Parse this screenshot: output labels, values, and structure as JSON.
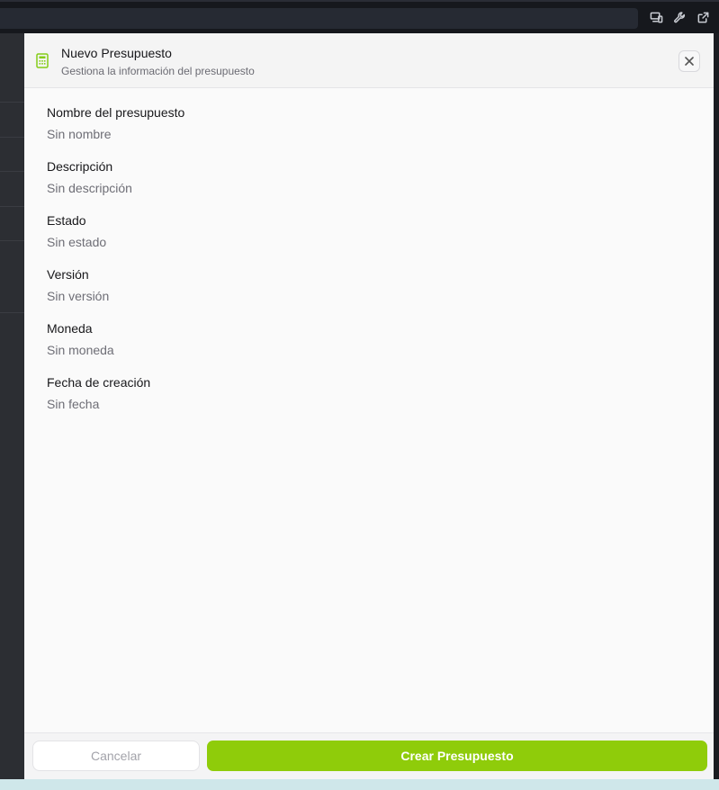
{
  "topbar": {
    "icons": [
      "devices-icon",
      "wrench-icon",
      "external-link-icon"
    ]
  },
  "modal": {
    "icon": "calculator-icon",
    "title": "Nuevo Presupuesto",
    "subtitle": "Gestiona la información del presupuesto",
    "close_icon": "close-icon",
    "fields": [
      {
        "label": "Nombre del presupuesto",
        "value": "Sin nombre"
      },
      {
        "label": "Descripción",
        "value": "Sin descripción"
      },
      {
        "label": "Estado",
        "value": "Sin estado"
      },
      {
        "label": "Versión",
        "value": "Sin versión"
      },
      {
        "label": "Moneda",
        "value": "Sin moneda"
      },
      {
        "label": "Fecha de creación",
        "value": "Sin fecha"
      }
    ],
    "footer": {
      "cancel_label": "Cancelar",
      "create_label": "Crear Presupuesto"
    }
  },
  "colors": {
    "accent": "#8fcc0a",
    "icon_accent": "#84cc16",
    "backdrop": "#1f2127"
  }
}
